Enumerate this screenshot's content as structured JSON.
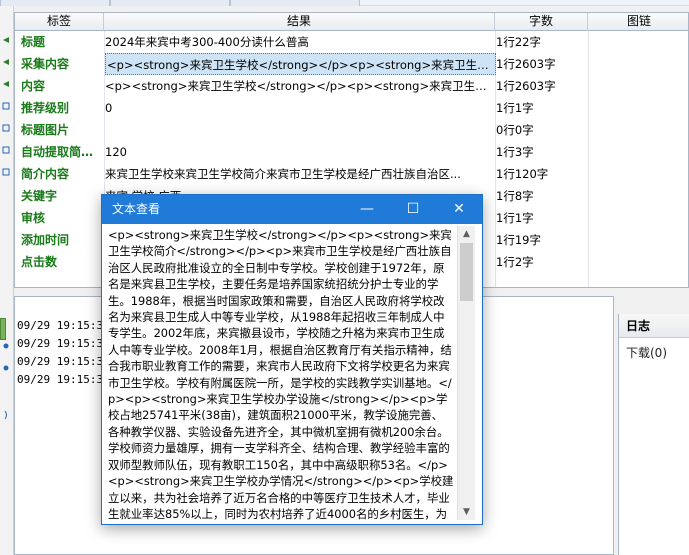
{
  "grid": {
    "columns": [
      "标签",
      "结果",
      "字数",
      "图链"
    ],
    "rows": [
      {
        "tag": "标题",
        "result": "2024年来宾中考300-400分读什么普高",
        "count": "1行22字"
      },
      {
        "tag": "采集内容",
        "result": "<p><strong>来宾卫生学校</strong></p><p><strong>来宾卫生学校简...",
        "count": "1行2603字"
      },
      {
        "tag": "内容",
        "result": "<p><strong>来宾卫生学校</strong></p><p><strong>来宾卫生学校简...",
        "count": "1行2603字"
      },
      {
        "tag": "推荐级别",
        "result": "0",
        "count": "1行1字"
      },
      {
        "tag": "标题图片",
        "result": "",
        "count": "0行0字"
      },
      {
        "tag": "自动提取简…",
        "result": "120",
        "count": "1行3字"
      },
      {
        "tag": "简介内容",
        "result": "来宾卫生学校来宾卫生学校简介来宾市卫生学校是经广西壮族自治区...",
        "count": "1行120字"
      },
      {
        "tag": "关键字",
        "result": "来宾,学校,广西",
        "count": "1行8字"
      },
      {
        "tag": "审核",
        "result": "",
        "count": "1行1字"
      },
      {
        "tag": "添加时间",
        "result": "",
        "count": "1行19字"
      },
      {
        "tag": "点击数",
        "result": "",
        "count": "1行2字"
      }
    ]
  },
  "log": {
    "lines": [
      "09/29 19:15:31",
      "09/29 19:15:32",
      "09/29 19:15:32",
      "09/29 19:15:32"
    ]
  },
  "side_panel": {
    "title": "日志",
    "item": "下载(0)"
  },
  "dialog": {
    "title": "文本查看",
    "minimize_glyph": "—",
    "maximize_glyph": "☐",
    "close_glyph": "✕",
    "text": "<p><strong>来宾卫生学校</strong></p><p><strong>来宾卫生学校简介</strong></p><p>来宾市卫生学校是经广西壮族自治区人民政府批准设立的全日制中专学校。学校创建于1972年，原名是来宾县卫生学校，主要任务是培养国家统招统分护士专业的学生。1988年，根据当时国家政策和需要，自治区人民政府将学校改名为来宾县卫生成人中等专业学校，从1988年起招收三年制成人中专学生。2002年底，来宾撤县设市，学校随之升格为来宾市卫生成人中等专业学校。2008年1月，根据自治区教育厅有关指示精神，结合我市职业教育工作的需要，来宾市人民政府下文将学校更名为来宾市卫生学校。学校有附属医院一所，是学校的实践教学实训基地。</p><p><strong>来宾卫生学校办学设施</strong></p><p>学校占地25741平米(38亩)，建筑面积21000平米，教学设施完善、各种教学仪器、实验设备先进齐全，其中微机室拥有微机200余台。学校师资力量雄厚，拥有一支学科齐全、结构合理、教学经验丰富的双师型教师队伍，现有教职工150名，其中中高级职称53名。</p><p><strong>来宾卫生学校办学情况</strong></p><p>学校建立以来，共为社会培养了近万名合格的中等医疗卫生技术人才，毕业生就业率达85%以上，同时为农村培养了近4000名的乡村医生，为稳定基层农村卫生队伍和提高基层医疗卫生服务质量作出了积极贡献。"
  },
  "colors": {
    "title_bar": "#1f7ad8",
    "tag_text": "#1a7a1a",
    "selection": "#cde4f7"
  }
}
